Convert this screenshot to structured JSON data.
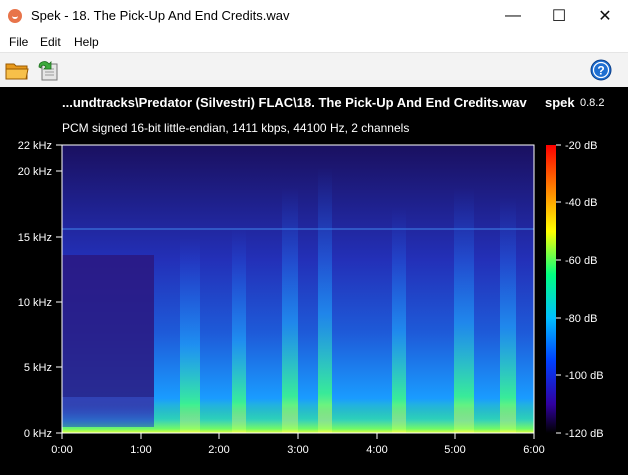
{
  "window": {
    "title": "Spek - 18. The Pick-Up And End Credits.wav"
  },
  "menu": [
    {
      "label": "File"
    },
    {
      "label": "Edit"
    },
    {
      "label": "Help"
    }
  ],
  "toolbar": {
    "icons": [
      "open-folder-icon",
      "save-icon",
      "help-icon"
    ]
  },
  "spectrogram": {
    "file_title": "...undtracks\\Predator (Silvestri) FLAC\\18. The Pick-Up And End Credits.wav",
    "app_name": "spek",
    "app_version": "0.8.2",
    "format_info": "PCM signed 16-bit little-endian, 1411 kbps, 44100 Hz, 2 channels",
    "freq_axis": [
      "22 kHz",
      "20 kHz",
      "15 kHz",
      "10 kHz",
      "5 kHz",
      "0 kHz"
    ],
    "time_axis": [
      "0:00",
      "1:00",
      "2:00",
      "3:00",
      "4:00",
      "5:00",
      "6:00"
    ],
    "db_scale": [
      "-20 dB",
      "-40 dB",
      "-60 dB",
      "-80 dB",
      "-100 dB",
      "-120 dB"
    ],
    "colors": {
      "background": "#000000",
      "low": "#1a0a6e",
      "mid": "#1e90ff",
      "high": "#ffff00",
      "peak": "#ff0000"
    }
  }
}
